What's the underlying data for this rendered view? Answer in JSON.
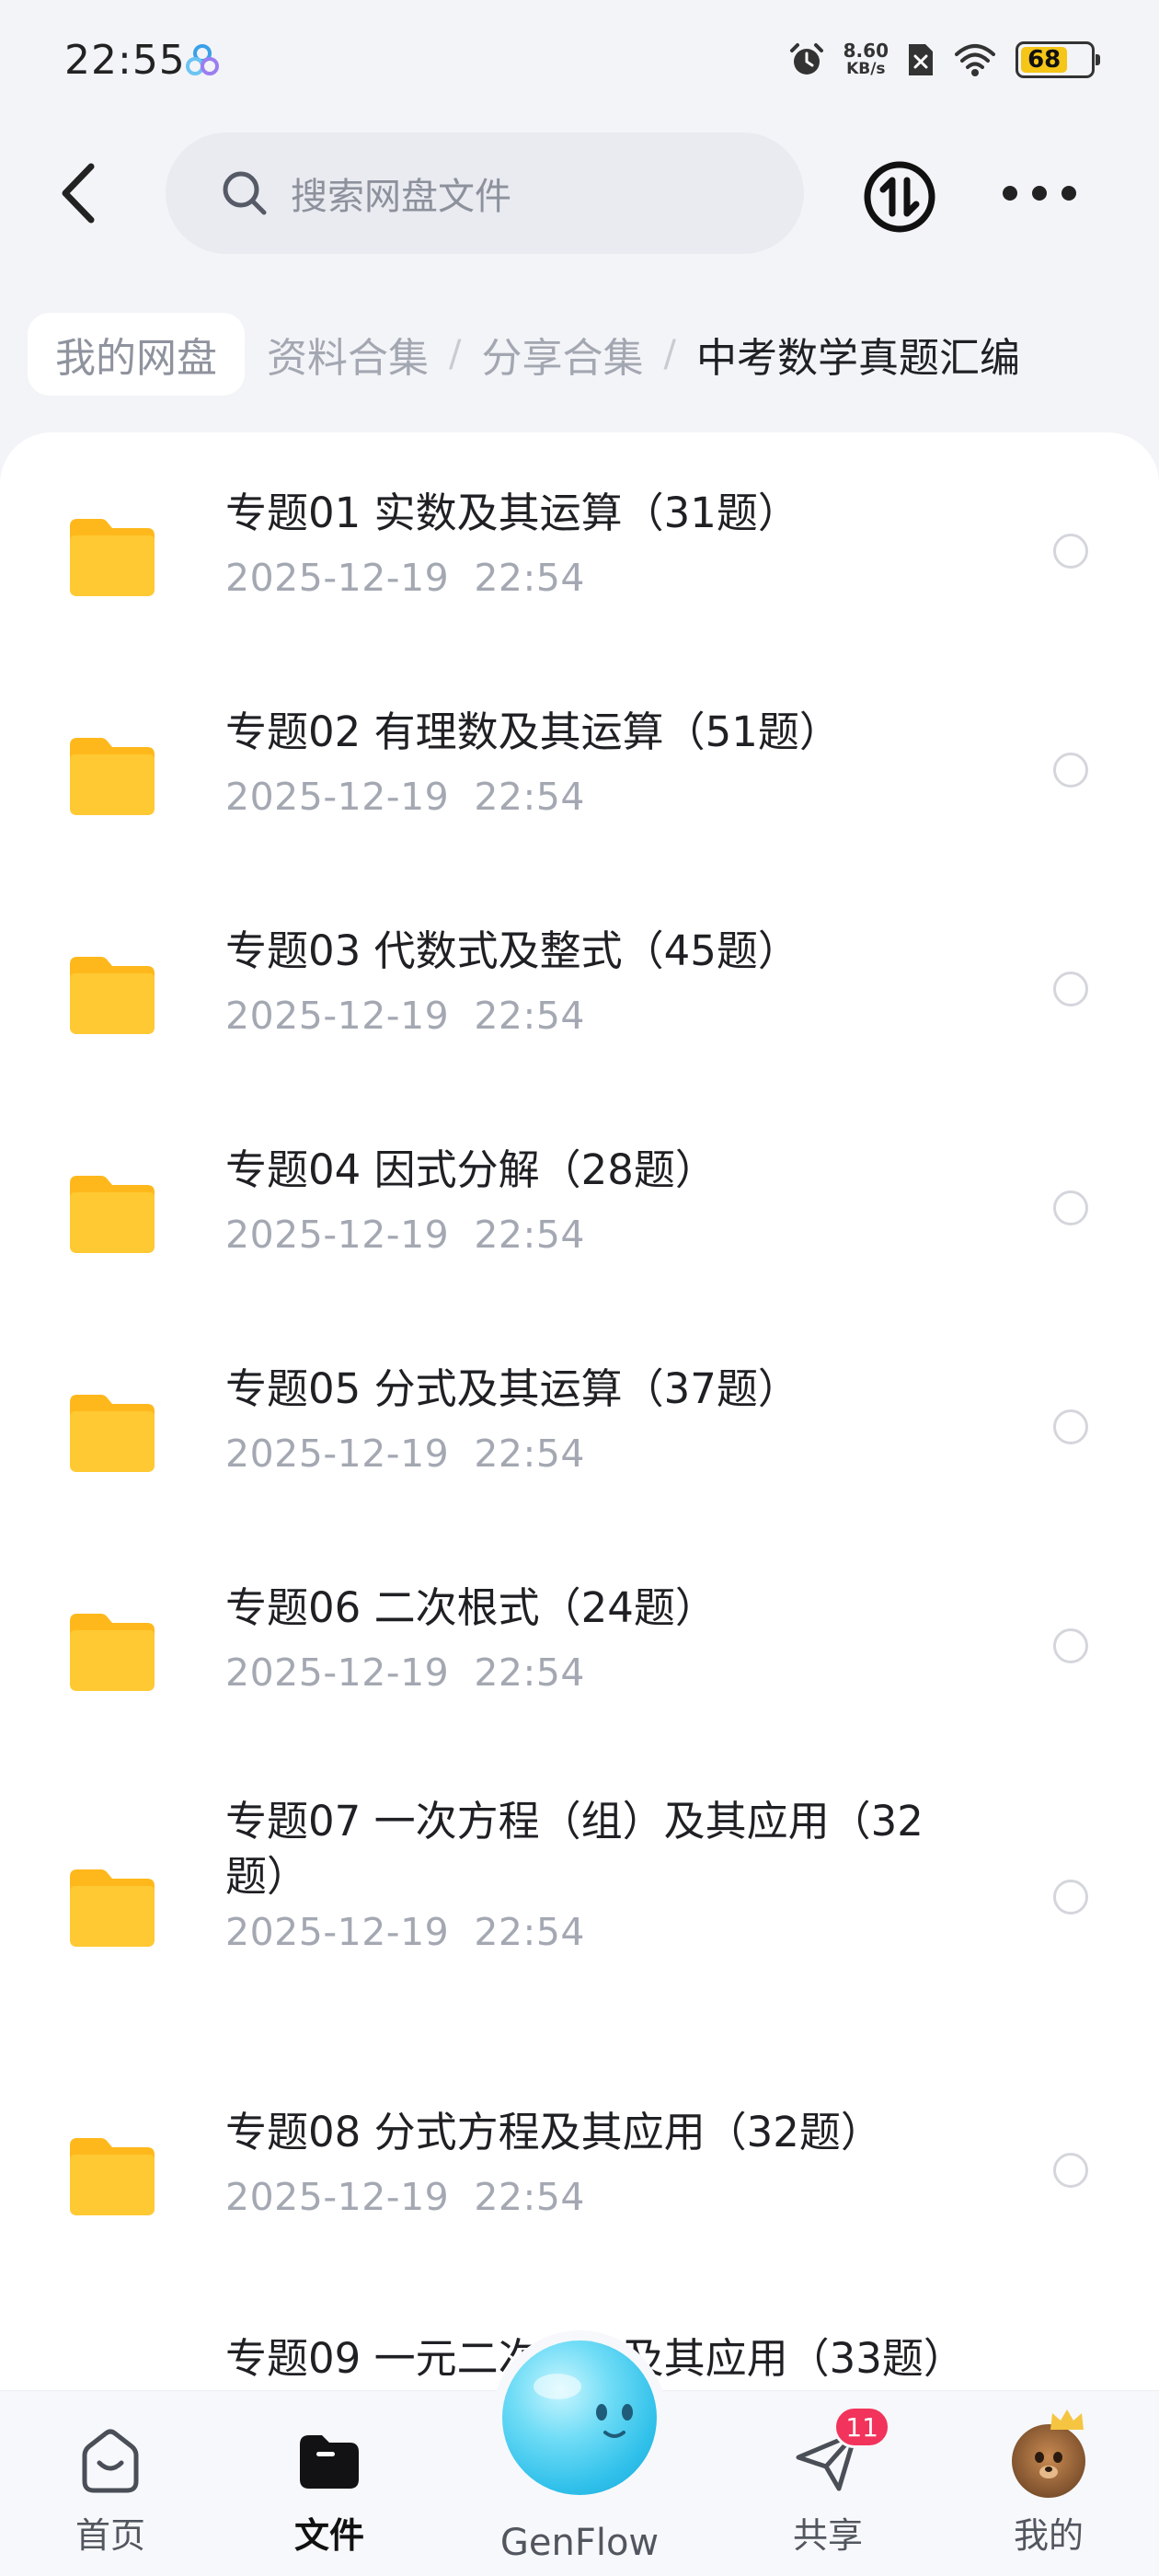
{
  "status_bar": {
    "time": "22:55",
    "net_speed_value": "8.60",
    "net_speed_unit": "KB/s",
    "battery_level": "68",
    "battery_color": "#f5c518",
    "icons": [
      "app-icon",
      "alarm-icon",
      "no-sim-icon",
      "wifi-icon",
      "battery-icon"
    ]
  },
  "header": {
    "search_placeholder": "搜索网盘文件",
    "icons": [
      "back-icon",
      "search-icon",
      "transfer-icon",
      "more-icon"
    ]
  },
  "breadcrumb": {
    "home": "我的网盘",
    "trail": [
      "资料合集",
      "分享合集"
    ],
    "separator": "/",
    "current": "中考数学真题汇编"
  },
  "files": [
    {
      "name": "专题01 实数及其运算（31题）",
      "date": "2025-12-19  22:54"
    },
    {
      "name": "专题02 有理数及其运算（51题）",
      "date": "2025-12-19  22:54"
    },
    {
      "name": "专题03 代数式及整式（45题）",
      "date": "2025-12-19  22:54"
    },
    {
      "name": "专题04 因式分解（28题）",
      "date": "2025-12-19  22:54"
    },
    {
      "name": "专题05 分式及其运算（37题）",
      "date": "2025-12-19  22:54"
    },
    {
      "name": "专题06 二次根式（24题）",
      "date": "2025-12-19  22:54"
    },
    {
      "name": "专题07 一次方程（组）及其应用（32题）",
      "date": "2025-12-19  22:54"
    },
    {
      "name": "专题08 分式方程及其应用（32题）",
      "date": "2025-12-19  22:54"
    },
    {
      "name": "专题09 一元二次方程及其应用（33题）",
      "date": ""
    }
  ],
  "folder_color": "#ffc933",
  "bottom_nav": {
    "home": "首页",
    "files": "文件",
    "genflow": "GenFlow",
    "share": "共享",
    "share_badge": "11",
    "mine": "我的"
  }
}
